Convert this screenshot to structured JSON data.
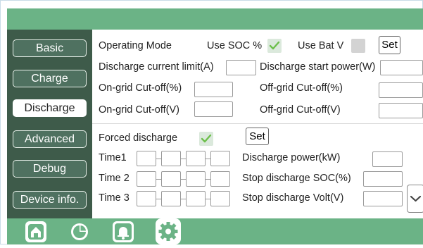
{
  "sidebar": {
    "items": [
      {
        "label": "Basic"
      },
      {
        "label": "Charge"
      },
      {
        "label": "Discharge"
      },
      {
        "label": "Advanced"
      },
      {
        "label": "Debug"
      },
      {
        "label": "Device info."
      }
    ],
    "active": "Discharge"
  },
  "mode": {
    "operating_mode_label": "Operating Mode",
    "use_soc_label": "Use SOC %",
    "use_soc_checked": true,
    "use_bat_v_label": "Use Bat V",
    "use_bat_v_checked": false,
    "set_label": "Set"
  },
  "limits": {
    "discharge_current_limit_label": "Discharge current limit(A)",
    "discharge_current_limit_value": "",
    "discharge_start_power_label": "Discharge start power(W)",
    "discharge_start_power_value": "",
    "ongrid_cutoff_pct_label": "On-grid Cut-off(%)",
    "ongrid_cutoff_pct_value": "",
    "offgrid_cutoff_pct_label": "Off-grid Cut-off(%)",
    "offgrid_cutoff_pct_value": "",
    "ongrid_cutoff_v_label": "On-grid Cut-off(V)",
    "ongrid_cutoff_v_value": "",
    "offgrid_cutoff_v_label": "Off-grid Cut-off(V)",
    "offgrid_cutoff_v_value": ""
  },
  "forced": {
    "label": "Forced discharge",
    "checked": true,
    "set_label": "Set",
    "time1_label": "Time1",
    "time2_label": "Time 2",
    "time3_label": "Time 3",
    "discharge_power_label": "Discharge power(kW)",
    "discharge_power_value": "",
    "stop_soc_label": "Stop discharge SOC(%)",
    "stop_soc_value": "",
    "stop_volt_label": "Stop discharge Volt(V)",
    "stop_volt_value": ""
  },
  "bottom_tabs": [
    {
      "icon": "home-icon"
    },
    {
      "icon": "pie-chart-icon"
    },
    {
      "icon": "bell-icon"
    },
    {
      "icon": "gear-icon"
    }
  ],
  "colors": {
    "accent_green": "#6bb386",
    "sidebar_bg": "#3e5b4a",
    "check_green": "#6cbf4a"
  }
}
